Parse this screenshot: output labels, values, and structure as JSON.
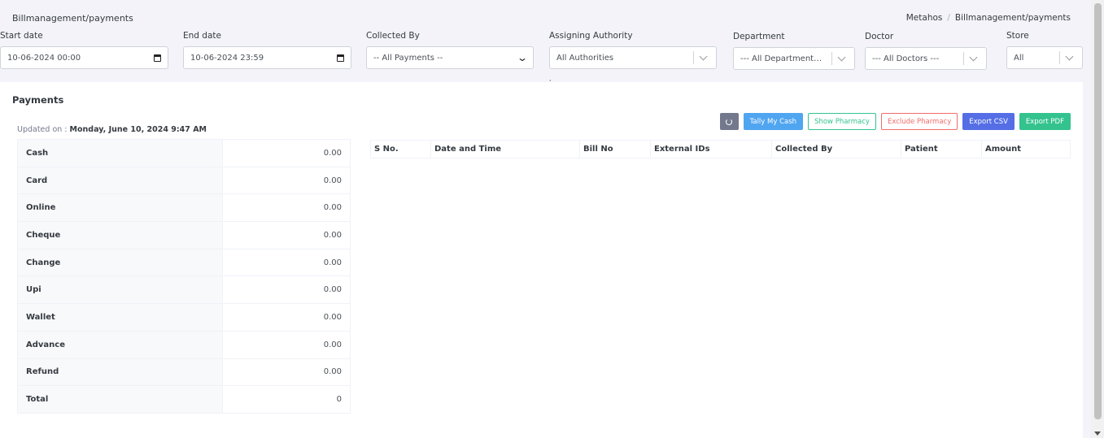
{
  "header": {
    "title": "Billmanagement/payments",
    "breadcrumb": [
      "Metahos",
      "Billmanagement/payments"
    ]
  },
  "filters": {
    "start_date": {
      "label": "Start date",
      "value": "10-06-2024 00:00"
    },
    "end_date": {
      "label": "End date",
      "value": "10-06-2024 23:59"
    },
    "collected_by": {
      "label": "Collected By",
      "value": "-- All Payments --"
    },
    "assigning_authority": {
      "label": "Assigning Authority",
      "value": "All Authorities"
    },
    "department": {
      "label": "Department",
      "value": "--- All Departments ---"
    },
    "doctor": {
      "label": "Doctor",
      "value": "--- All Doctors ---"
    },
    "store": {
      "label": "Store",
      "value": "All"
    }
  },
  "payments": {
    "title": "Payments",
    "updated_label": "Updated on : ",
    "updated_value": "Monday, June 10, 2024 9:47 AM",
    "summary": [
      {
        "label": "Cash",
        "value": "0.00"
      },
      {
        "label": "Card",
        "value": "0.00"
      },
      {
        "label": "Online",
        "value": "0.00"
      },
      {
        "label": "Cheque",
        "value": "0.00"
      },
      {
        "label": "Change",
        "value": "0.00"
      },
      {
        "label": "Upi",
        "value": "0.00"
      },
      {
        "label": "Wallet",
        "value": "0.00"
      },
      {
        "label": "Advance",
        "value": "0.00"
      },
      {
        "label": "Refund",
        "value": "0.00"
      },
      {
        "label": "Total",
        "value": "0"
      }
    ],
    "buttons": {
      "tally": "Tally My Cash",
      "show_pharmacy": "Show Pharmacy",
      "exclude_pharmacy": "Exclude Pharmacy",
      "export_csv": "Export CSV",
      "export_pdf": "Export PDF"
    },
    "columns": [
      "S No.",
      "Date and Time",
      "Bill No",
      "External IDs",
      "Collected By",
      "Patient",
      "Amount"
    ]
  },
  "icons": {
    "calendar": "calendar-icon",
    "chevron": "chevron-down-icon",
    "refresh": "refresh-icon"
  },
  "colors": {
    "refresh": "#74788d",
    "tally": "#50a5f1",
    "show": "#34c38f",
    "exclude": "#f46a6a",
    "csv": "#556ee6",
    "pdf": "#34c38f"
  }
}
